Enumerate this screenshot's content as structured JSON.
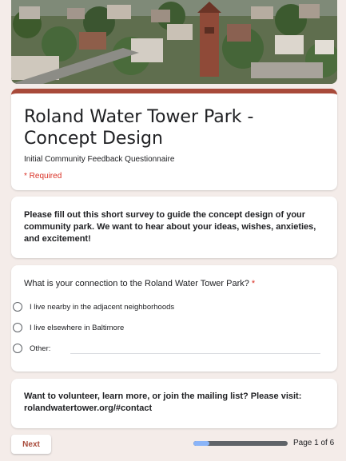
{
  "header_image": {
    "icon": "aerial-neighborhood-photo"
  },
  "form": {
    "title": "Roland Water Tower Park - Concept Design",
    "subtitle": "Initial Community Feedback Questionnaire",
    "required_note": "* Required",
    "accent_color": "#a84a3a",
    "required_color": "#d93025"
  },
  "description": {
    "text": "Please fill out this short survey to guide the concept design of your community park. We want to hear about your ideas, wishes, anxieties, and excitement!"
  },
  "question": {
    "text": "What is your connection to the Roland Water Tower Park?",
    "required_mark": "*",
    "options": [
      {
        "label": "I live nearby in the adjacent neighborhoods"
      },
      {
        "label": "I live elsewhere in Baltimore"
      },
      {
        "label": "Other:"
      }
    ],
    "other_value": ""
  },
  "volunteer": {
    "text": "Want to volunteer, learn more, or join the mailing list? Please visit: rolandwatertower.org/#contact"
  },
  "footer": {
    "next_label": "Next",
    "page_indicator": "Page 1 of 6",
    "progress_fraction": 0.1667
  }
}
